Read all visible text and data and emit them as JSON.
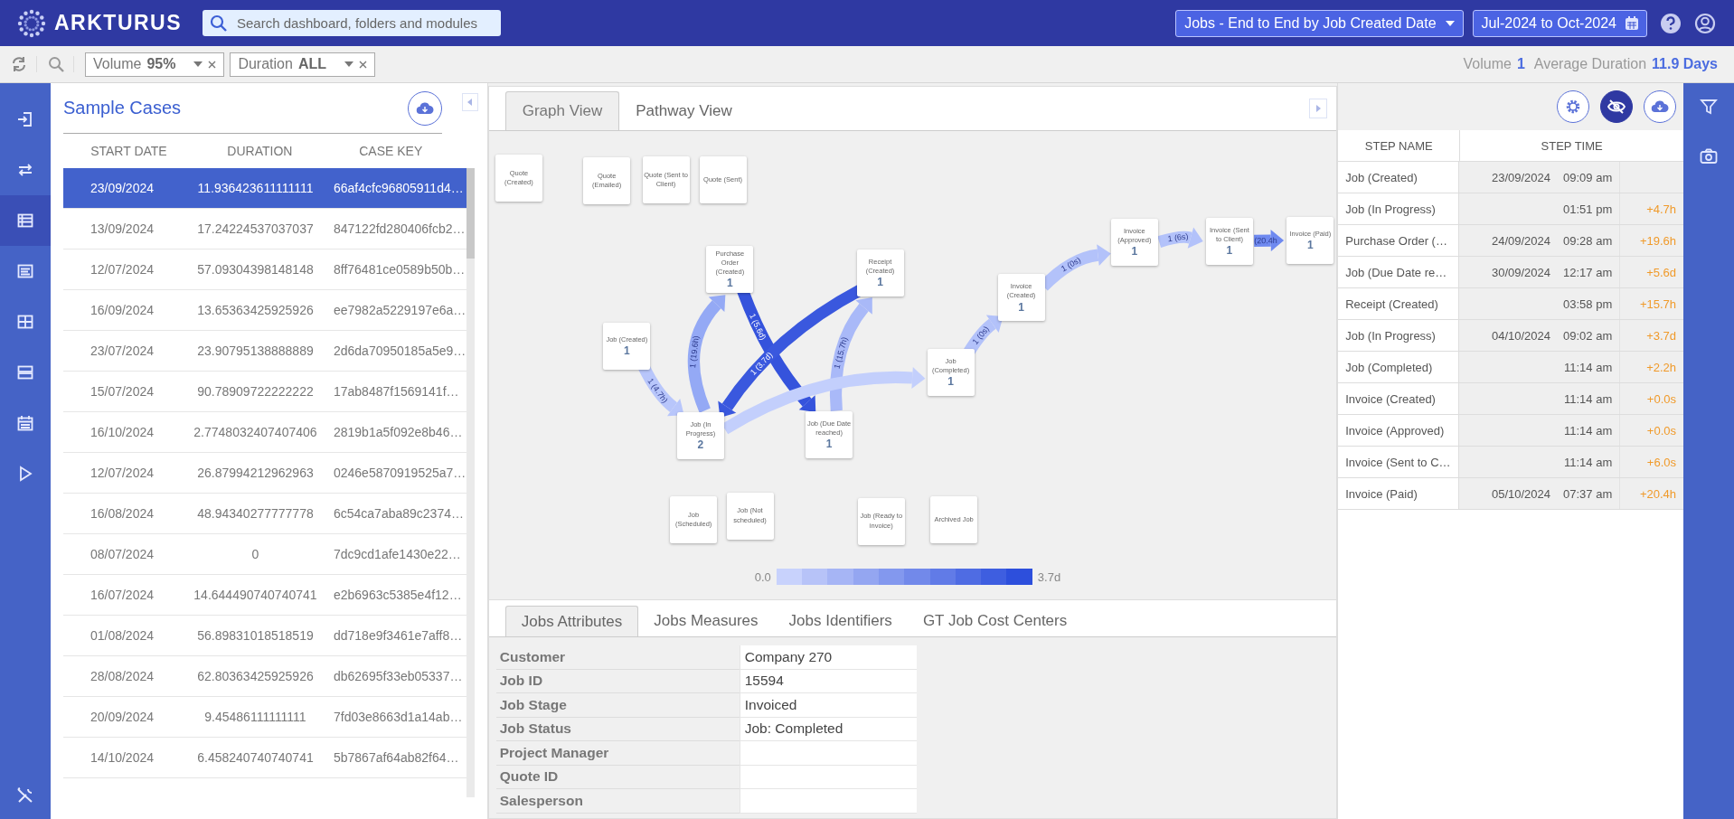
{
  "header": {
    "logo": "ARKTURUS",
    "search": {
      "placeholder": "Search dashboard, folders and modules"
    },
    "process_select": "Jobs - End to End by Job Created Date",
    "date_range": "Jul-2024 to Oct-2024"
  },
  "toolbar": {
    "filters": [
      {
        "label": "Volume",
        "value": "95%"
      },
      {
        "label": "Duration",
        "value": "ALL"
      }
    ],
    "summary": {
      "volume_label": "Volume",
      "volume": "1",
      "duration_label": "Average Duration",
      "duration": "11.9 Days"
    }
  },
  "nav": [
    {
      "selected": false
    },
    {
      "selected": false
    },
    {
      "selected": true
    },
    {
      "selected": false
    },
    {
      "selected": false
    },
    {
      "selected": false
    },
    {
      "selected": false
    },
    {
      "selected": false
    }
  ],
  "sample_cases": {
    "title": "Sample Cases",
    "columns": [
      "START DATE",
      "DURATION",
      "CASE KEY"
    ],
    "rows": [
      {
        "start_date": "23/09/2024",
        "duration": "11.936423611111111",
        "case_key": "66af4cfc96805911d4…",
        "selected": true
      },
      {
        "start_date": "13/09/2024",
        "duration": "17.24224537037037",
        "case_key": "847122fd280406fcb2…",
        "selected": false
      },
      {
        "start_date": "12/07/2024",
        "duration": "57.09304398148148",
        "case_key": "8ff76481ce0589b50b…",
        "selected": false
      },
      {
        "start_date": "16/09/2024",
        "duration": "13.65363425925926",
        "case_key": "ee7982a5229197e6a…",
        "selected": false
      },
      {
        "start_date": "23/07/2024",
        "duration": "23.90795138888889",
        "case_key": "2d6da70950185a5e9…",
        "selected": false
      },
      {
        "start_date": "15/07/2024",
        "duration": "90.78909722222222",
        "case_key": "17ab8487f1569141f…",
        "selected": false
      },
      {
        "start_date": "16/10/2024",
        "duration": "2.7748032407407406",
        "case_key": "2819b1a5f092e8b46…",
        "selected": false
      },
      {
        "start_date": "12/07/2024",
        "duration": "26.87994212962963",
        "case_key": "0246e5870919525a7…",
        "selected": false
      },
      {
        "start_date": "16/08/2024",
        "duration": "48.94340277777778",
        "case_key": "6c54ca7aba89c2374…",
        "selected": false
      },
      {
        "start_date": "08/07/2024",
        "duration": "0",
        "case_key": "7dc9cd1afe1430e22…",
        "selected": false
      },
      {
        "start_date": "16/07/2024",
        "duration": "14.644490740740741",
        "case_key": "e2b6963c5385e4f12…",
        "selected": false
      },
      {
        "start_date": "01/08/2024",
        "duration": "56.89831018518519",
        "case_key": "dd718e9f3461e7aff8…",
        "selected": false
      },
      {
        "start_date": "28/08/2024",
        "duration": "62.80363425925926",
        "case_key": "db62695f33eb05337…",
        "selected": false
      },
      {
        "start_date": "20/09/2024",
        "duration": "9.45486111111111",
        "case_key": "7fd03e8663d1a14ab…",
        "selected": false
      },
      {
        "start_date": "14/10/2024",
        "duration": "6.458240740740741",
        "case_key": "5b7867af64ab82f64…",
        "selected": false
      }
    ]
  },
  "graph": {
    "tabs": [
      {
        "label": "Graph View",
        "selected": true
      },
      {
        "label": "Pathway View",
        "selected": false
      }
    ],
    "nodes": [
      {
        "label": "Quote (Created)"
      },
      {
        "label": "Quote (Emailed)"
      },
      {
        "label": "Quote (Sent to Client)"
      },
      {
        "label": "Quote (Sent)"
      },
      {
        "label": "Purchase Order (Created)",
        "count": "1"
      },
      {
        "label": "Receipt (Created)",
        "count": "1"
      },
      {
        "label": "Job (Created)",
        "count": "1"
      },
      {
        "label": "Job (In Progress)",
        "count": "2"
      },
      {
        "label": "Job (Due Date reached)",
        "count": "1"
      },
      {
        "label": "Job (Completed)",
        "count": "1"
      },
      {
        "label": "Invoice (Created)",
        "count": "1"
      },
      {
        "label": "Invoice (Approved)",
        "count": "1"
      },
      {
        "label": "Invoice (Sent to Client)",
        "count": "1"
      },
      {
        "label": "Invoice (Paid)",
        "count": "1"
      },
      {
        "label": "Job (Scheduled)"
      },
      {
        "label": "Job (Not scheduled)"
      },
      {
        "label": "Job (Ready to invoice)"
      },
      {
        "label": "Archived Job"
      }
    ],
    "edges": [
      {
        "label": "1 (4.7h)",
        "color": "#b8c6fb"
      },
      {
        "label": "1 (19.6h)",
        "color": "#94a9f5"
      },
      {
        "label": "1 (5.6d)",
        "color": "#3553dc"
      },
      {
        "label": "1 (3.7d)",
        "color": "#3a58de"
      },
      {
        "label": "1 (15.7h)",
        "color": "#a9b9f8"
      },
      {
        "color": "#c3cffc"
      },
      {
        "label": "1 (0s)",
        "color": "#b3c2fa"
      },
      {
        "label": "1 (0s)",
        "color": "#b3c2fa"
      },
      {
        "label": "1 (6s)",
        "color": "#b3c2fa"
      },
      {
        "label": "(20.4h",
        "color": "#6f8af0"
      }
    ],
    "legend": {
      "min": "0.0",
      "max": "3.7d"
    }
  },
  "attributes": {
    "tabs": [
      {
        "label": "Jobs Attributes",
        "selected": true
      },
      {
        "label": "Jobs Measures",
        "selected": false
      },
      {
        "label": "Jobs Identifiers",
        "selected": false
      },
      {
        "label": "GT Job Cost Centers",
        "selected": false
      }
    ],
    "rows": [
      {
        "label": "Customer",
        "value": "Company 270"
      },
      {
        "label": "Job ID",
        "value": "15594"
      },
      {
        "label": "Job Stage",
        "value": "Invoiced"
      },
      {
        "label": "Job Status",
        "value": "Job: Completed"
      },
      {
        "label": "Project Manager"
      },
      {
        "label": "Quote ID"
      },
      {
        "label": "Salesperson"
      }
    ]
  },
  "steps": {
    "tools": [
      {
        "on": false
      },
      {
        "on": true
      },
      {
        "on": false
      }
    ],
    "columns": [
      "STEP NAME",
      "STEP TIME"
    ],
    "rows": [
      {
        "name": "Job (Created)",
        "date": "23/09/2024",
        "time": "09:09 am"
      },
      {
        "name": "Job (In Progress)",
        "time": "01:51 pm",
        "delta": "+4.7h"
      },
      {
        "name": "Purchase Order (…",
        "date": "24/09/2024",
        "time": "09:28 am",
        "delta": "+19.6h"
      },
      {
        "name": "Job (Due Date re…",
        "date": "30/09/2024",
        "time": "12:17 am",
        "delta": "+5.6d"
      },
      {
        "name": "Receipt (Created)",
        "time": "03:58 pm",
        "delta": "+15.7h"
      },
      {
        "name": "Job (In Progress)",
        "date": "04/10/2024",
        "time": "09:02 am",
        "delta": "+3.7d"
      },
      {
        "name": "Job (Completed)",
        "time": "11:14 am",
        "delta": "+2.2h"
      },
      {
        "name": "Invoice (Created)",
        "time": "11:14 am",
        "delta": "+0.0s"
      },
      {
        "name": "Invoice (Approved)",
        "time": "11:14 am",
        "delta": "+0.0s"
      },
      {
        "name": "Invoice (Sent to C…",
        "time": "11:14 am",
        "delta": "+6.0s"
      },
      {
        "name": "Invoice (Paid)",
        "date": "05/10/2024",
        "time": "07:37 am",
        "delta": "+20.4h"
      }
    ]
  }
}
